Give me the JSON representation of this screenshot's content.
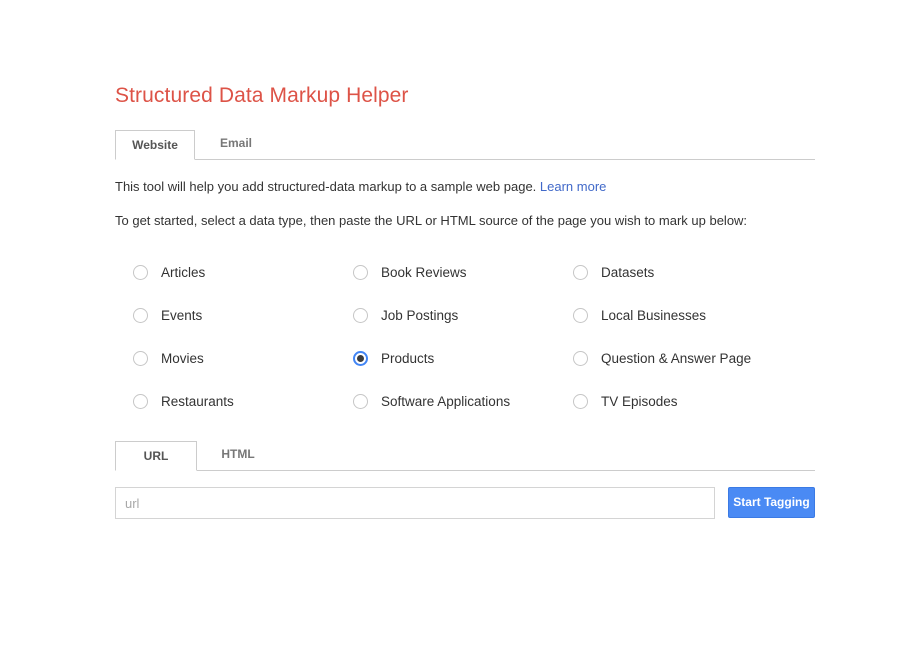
{
  "app": {
    "title": "Structured Data Markup Helper",
    "title_color": "#dd5347"
  },
  "main_tabs": [
    {
      "label": "Website",
      "active": true
    },
    {
      "label": "Email",
      "active": false
    }
  ],
  "intro": {
    "line1_text": "This tool will help you add structured-data markup to a sample web page.",
    "line1_link": "Learn more",
    "line2_text": "To get started, select a data type, then paste the URL or HTML source of the page you wish to mark up below:"
  },
  "data_types": {
    "selected": "Products",
    "columns": [
      {
        "items": [
          {
            "label": "Articles",
            "selected": false
          },
          {
            "label": "Events",
            "selected": false
          },
          {
            "label": "Movies",
            "selected": false
          },
          {
            "label": "Restaurants",
            "selected": false
          }
        ]
      },
      {
        "items": [
          {
            "label": "Book Reviews",
            "selected": false
          },
          {
            "label": "Job Postings",
            "selected": false
          },
          {
            "label": "Products",
            "selected": true
          },
          {
            "label": "Software Applications",
            "selected": false
          }
        ]
      },
      {
        "items": [
          {
            "label": "Datasets",
            "selected": false
          },
          {
            "label": "Local Businesses",
            "selected": false
          },
          {
            "label": "Question & Answer Page",
            "selected": false
          },
          {
            "label": "TV Episodes",
            "selected": false
          }
        ]
      }
    ]
  },
  "source_tabs": [
    {
      "label": "URL",
      "active": true
    },
    {
      "label": "HTML",
      "active": false
    }
  ],
  "source_input": {
    "value": "",
    "placeholder": "url"
  },
  "actions": {
    "start_tagging_label": "Start Tagging",
    "start_tagging_color": "#4a8af4"
  }
}
